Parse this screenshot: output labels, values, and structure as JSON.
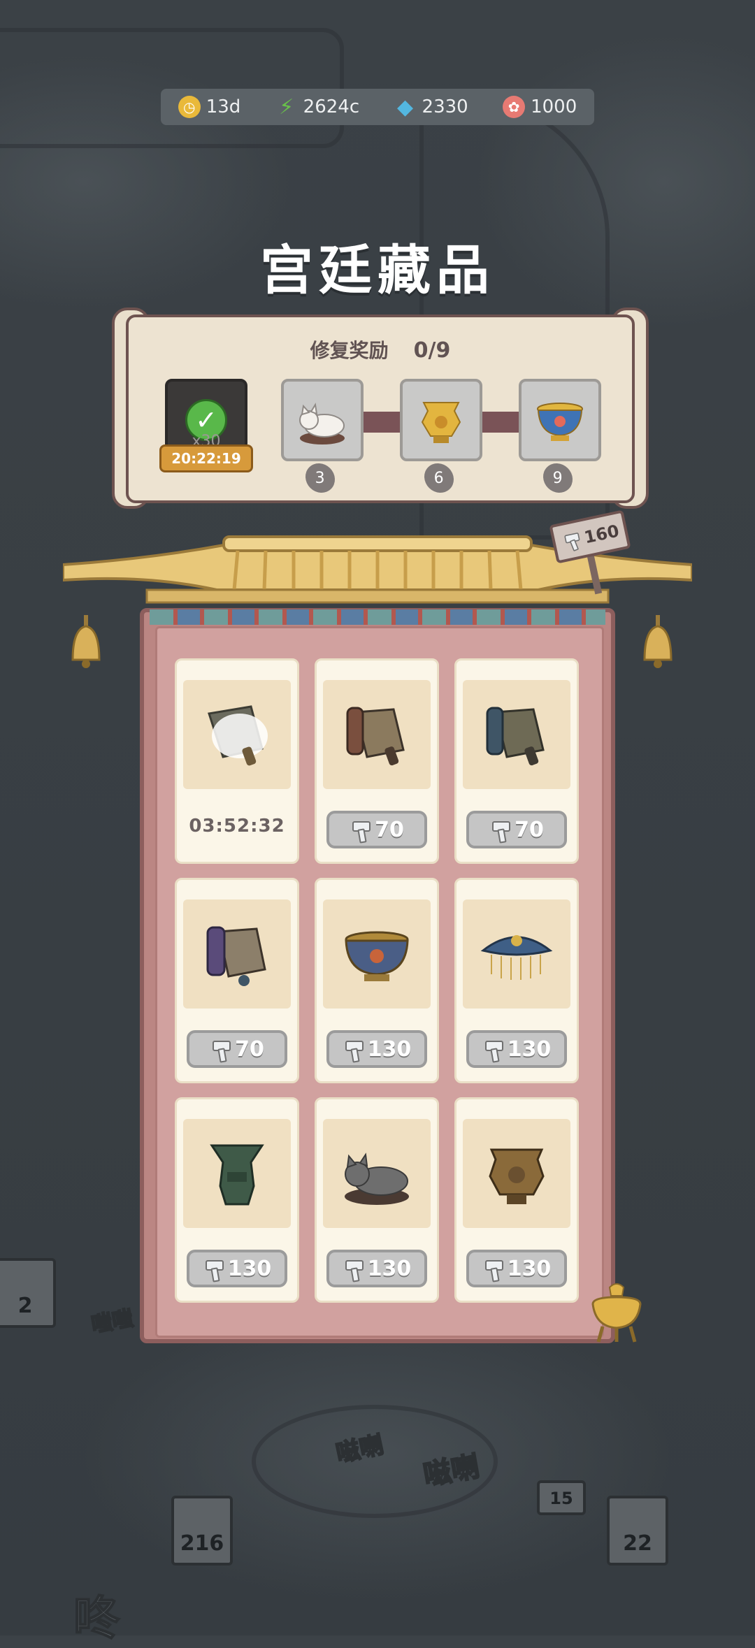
{
  "resources": [
    {
      "icon": "gold-clock-icon",
      "value": "13d",
      "color": "#e9b93a"
    },
    {
      "icon": "lightning-energy-icon",
      "value": "2624c",
      "color": "#69c24a"
    },
    {
      "icon": "diamond-icon",
      "value": "2330",
      "color": "#53b7e0"
    },
    {
      "icon": "shell-icon",
      "value": "1000",
      "color": "#e77a73"
    }
  ],
  "title": "宫廷藏品",
  "rewards": {
    "label": "修复奖励",
    "progress": "0/9",
    "first": {
      "claimed": true,
      "multiplier": "x30",
      "timer": "20:22:19"
    },
    "milestones": [
      {
        "need": "3",
        "icon": "sleeping-cat-figurine-icon"
      },
      {
        "need": "6",
        "icon": "golden-vase-icon"
      },
      {
        "need": "9",
        "icon": "cloisonne-bowl-icon"
      }
    ]
  },
  "hammer_sign": "160",
  "items": [
    {
      "name": "scroll-light",
      "icon": "scroll-icon",
      "countdown": "03:52:32",
      "cost": null
    },
    {
      "name": "scroll-brown",
      "icon": "scroll-icon",
      "countdown": null,
      "cost": "70"
    },
    {
      "name": "scroll-dark",
      "icon": "scroll-icon",
      "countdown": null,
      "cost": "70"
    },
    {
      "name": "scroll-purple",
      "icon": "scroll-icon",
      "countdown": null,
      "cost": "70"
    },
    {
      "name": "cloisonne-bowl",
      "icon": "cloisonne-bowl-icon",
      "countdown": null,
      "cost": "130"
    },
    {
      "name": "beaded-hat",
      "icon": "beaded-hat-icon",
      "countdown": null,
      "cost": "130"
    },
    {
      "name": "bronze-vessel",
      "icon": "bronze-vessel-icon",
      "countdown": null,
      "cost": "130"
    },
    {
      "name": "sleeping-cat",
      "icon": "sleeping-cat-figurine-icon",
      "countdown": null,
      "cost": "130"
    },
    {
      "name": "bronze-urn",
      "icon": "bronze-urn-icon",
      "countdown": null,
      "cost": "130"
    }
  ],
  "background_text": {
    "sign_left": "2",
    "sign_bottom_left": "216",
    "sign_bottom_right": "22",
    "tag_right": "15",
    "sfx_left": "嗤嗤",
    "sfx_center_a": "嗞喇",
    "sfx_center_b": "嗞喇",
    "sfx_bottom": "咚"
  }
}
